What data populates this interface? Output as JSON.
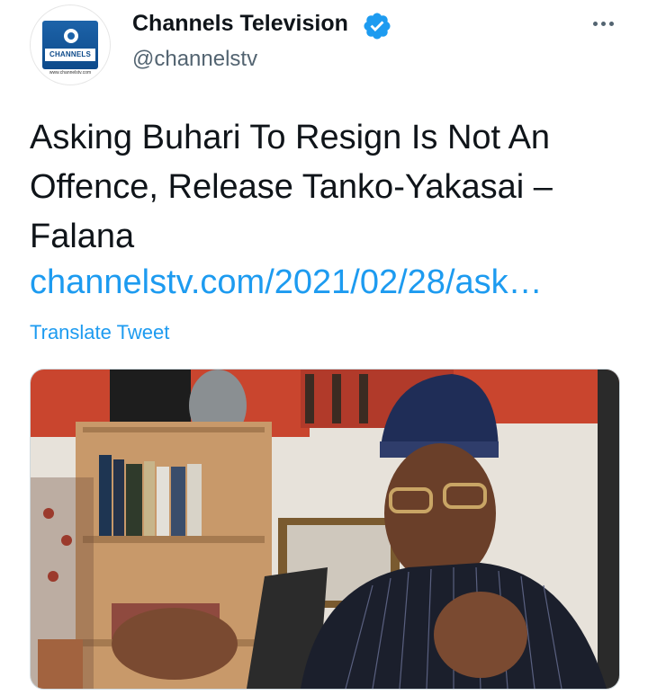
{
  "tweet": {
    "author": {
      "display_name": "Channels Television",
      "handle": "@channelstv",
      "verified": true,
      "avatar_icon": "channels-tv-logo-icon",
      "avatar_logo_text": "CHANNELS",
      "avatar_url_text": "www.channelstv.com"
    },
    "text": "Asking Buhari To Resign Is Not An Offence, Release Tanko-Yakasai – Falana",
    "link": "channelstv.com/2021/02/28/ask…",
    "translate_label": "Translate Tweet",
    "more_icon": "more-options-icon"
  },
  "colors": {
    "link": "#1d9bf0",
    "verified_badge": "#1d9bf0",
    "text": "#0f1419",
    "secondary_text": "#536471"
  }
}
